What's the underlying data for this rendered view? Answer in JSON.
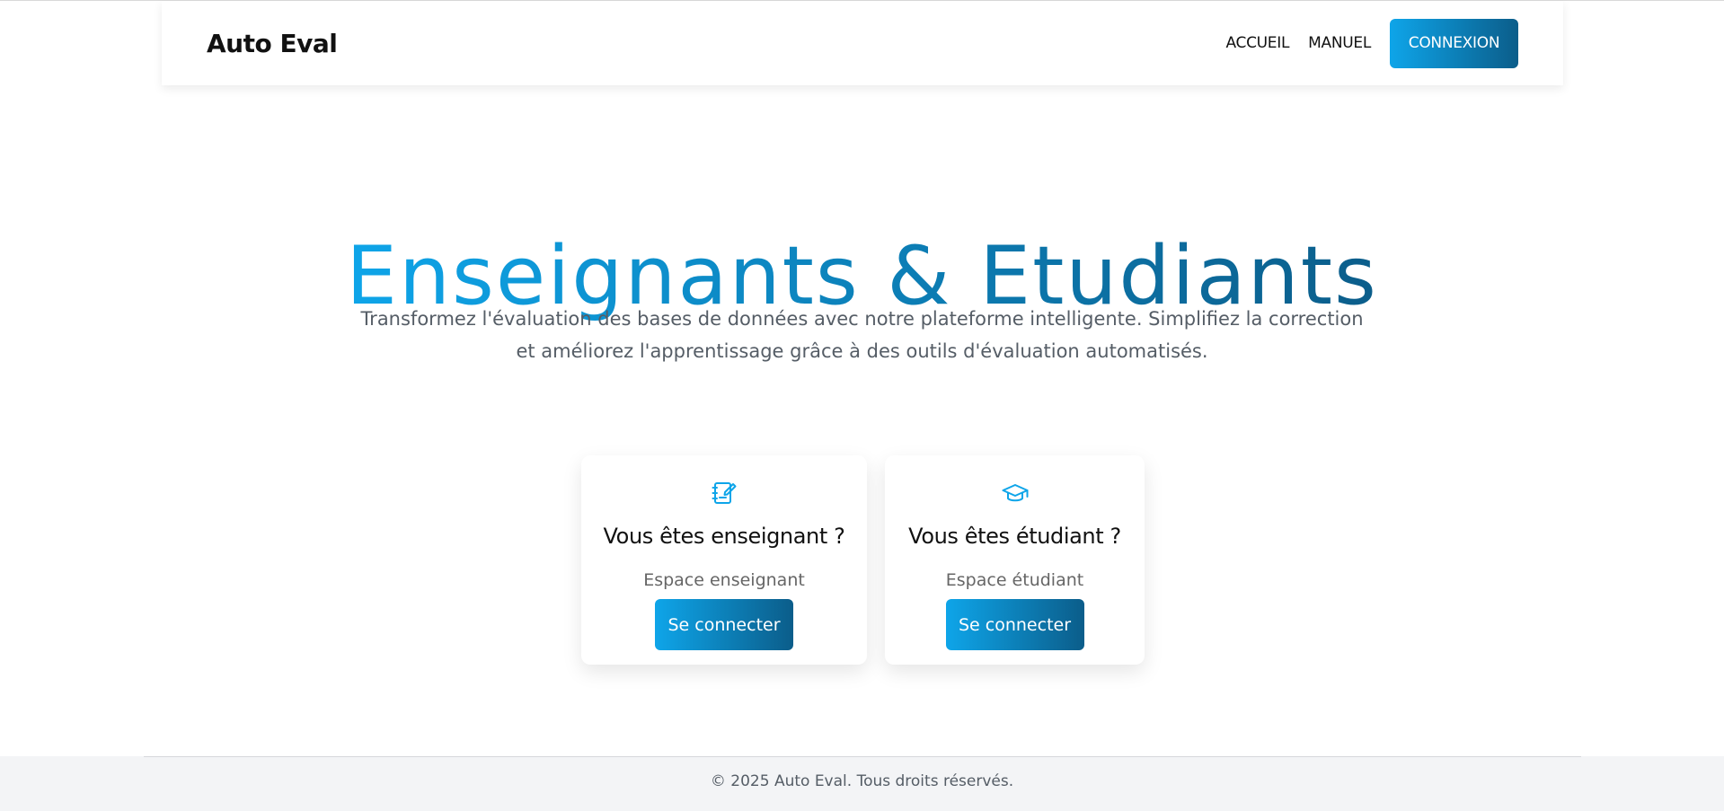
{
  "nav": {
    "brand": "Auto Eval",
    "links": [
      "ACCUEIL",
      "MANUEL"
    ],
    "cta": "CONNEXION"
  },
  "hero": {
    "title": "Enseignants & Etudiants",
    "subtitle": "Transformez l'évaluation des bases de données avec notre plateforme intelligente. Simplifiez la correction et améliorez l'apprentissage grâce à des outils d'évaluation automatisés."
  },
  "cards": [
    {
      "icon": "notebook-edit-icon",
      "title": "Vous êtes enseignant ?",
      "subtitle": "Espace enseignant",
      "button": "Se connecter"
    },
    {
      "icon": "graduation-cap-icon",
      "title": "Vous êtes étudiant ?",
      "subtitle": "Espace étudiant",
      "button": "Se connecter"
    }
  ],
  "footer": {
    "text": "© 2025 Auto Eval. Tous droits réservés."
  },
  "colors": {
    "accent_start": "#0ea5e9",
    "accent_end": "#0b5d8a",
    "footer_bg": "#f3f4f6"
  }
}
